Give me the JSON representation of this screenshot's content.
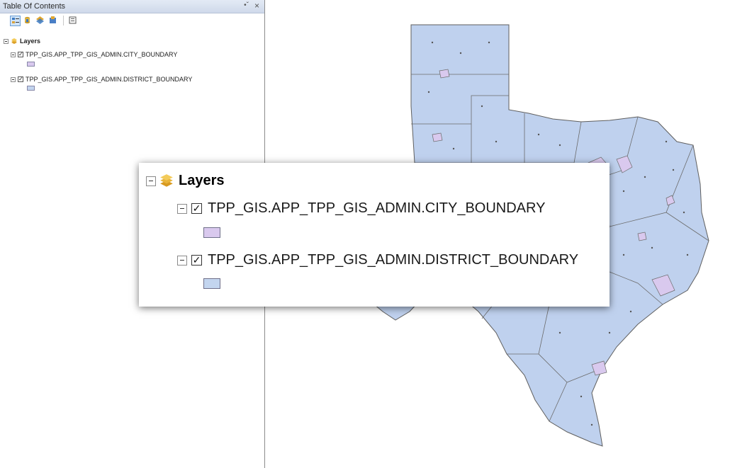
{
  "toc": {
    "title": "Table Of Contents",
    "toolbar": [
      {
        "icon": "list-by-drawing-order-icon",
        "active": true
      },
      {
        "icon": "list-by-source-icon"
      },
      {
        "icon": "list-by-visibility-icon"
      },
      {
        "icon": "list-by-selection-icon"
      },
      {
        "icon": "options-icon"
      }
    ],
    "root_label": "Layers",
    "layers": [
      {
        "name": "TPP_GIS.APP_TPP_GIS_ADMIN.CITY_BOUNDARY",
        "checked": true,
        "swatch_color": "#d9c9ee"
      },
      {
        "name": "TPP_GIS.APP_TPP_GIS_ADMIN.DISTRICT_BOUNDARY",
        "checked": true,
        "swatch_color": "#c3d5ef"
      }
    ]
  },
  "callout": {
    "root_label": "Layers",
    "layers": [
      {
        "name": "TPP_GIS.APP_TPP_GIS_ADMIN.CITY_BOUNDARY",
        "swatch_color": "#d9c9ee"
      },
      {
        "name": "TPP_GIS.APP_TPP_GIS_ADMIN.DISTRICT_BOUNDARY",
        "swatch_color": "#c3d5ef"
      }
    ]
  },
  "map": {
    "fill_color": "#bfd1ee",
    "boundary_color": "#6b6b6b",
    "city_color": "#d9c9ee"
  }
}
